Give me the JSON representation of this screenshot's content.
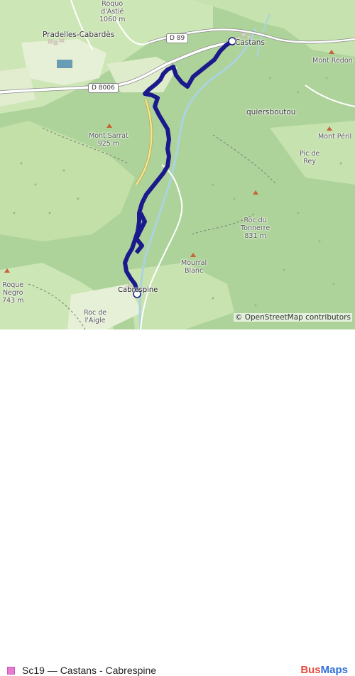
{
  "map": {
    "attribution": "© OpenStreetMap contributors",
    "colors": {
      "forest": "#aed39a",
      "meadow": "#cde6b5",
      "field": "#e6f0d6",
      "water": "#aad3df",
      "route": "#1a1a8c",
      "road": "#ffffff",
      "road_yellow": "#f2e691"
    },
    "places": [
      {
        "id": "pradelles",
        "name": "Pradelles-Cabardès"
      },
      {
        "id": "castans",
        "name": "Castans"
      },
      {
        "id": "quiersboutou",
        "name": "quiersboutou"
      },
      {
        "id": "cabrespine",
        "name": "Cabrespine"
      }
    ],
    "peaks": [
      {
        "id": "roquo",
        "name": "Roquo",
        "name2": "d'Astié",
        "elevation": "1060 m"
      },
      {
        "id": "redon",
        "name": "Mont Redon"
      },
      {
        "id": "sarrat",
        "name": "Mont Sarrat",
        "elevation": "925 m"
      },
      {
        "id": "peril",
        "name": "Mont Péril"
      },
      {
        "id": "picrey",
        "name": "Pic de",
        "name2": "Rey"
      },
      {
        "id": "tonnerre",
        "name": "Roc du",
        "name2": "Tonnerre",
        "elevation": "831 m"
      },
      {
        "id": "mourral",
        "name": "Mourral",
        "name2": "Blanc"
      },
      {
        "id": "roquenegro",
        "name": "Roque",
        "name2": "Negro",
        "elevation": "743 m"
      },
      {
        "id": "aigle",
        "name": "Roc de",
        "name2": "l'Aigle"
      }
    ],
    "roads": [
      {
        "id": "d89",
        "ref": "D 89"
      },
      {
        "id": "d8006",
        "ref": "D 8006"
      }
    ],
    "stops": [
      {
        "id": "start",
        "name": "Castans"
      },
      {
        "id": "end",
        "name": "Cabrespine"
      }
    ]
  },
  "legend": {
    "route_color": "#e87ad0",
    "label": "Sc19 — Castans - Cabrespine"
  },
  "brand": {
    "part1": "Bus",
    "part2": "Maps"
  }
}
